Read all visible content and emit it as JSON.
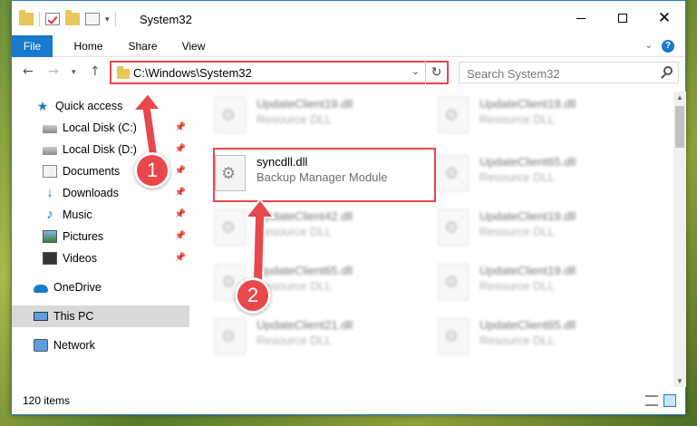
{
  "window": {
    "title": "System32",
    "qat_dropdown_arrow": "▾"
  },
  "ribbon": {
    "tabs": [
      "File",
      "Home",
      "Share",
      "View"
    ],
    "help": "?"
  },
  "navbar": {
    "address": "C:\\Windows\\System32",
    "search_placeholder": "Search System32"
  },
  "sidebar": {
    "items": [
      {
        "label": "Quick access",
        "icon": "star-icon",
        "pinned": false
      },
      {
        "label": "Local Disk (C:)",
        "icon": "drive-icon",
        "pinned": true
      },
      {
        "label": "Local Disk (D:)",
        "icon": "drive-icon",
        "pinned": true
      },
      {
        "label": "Documents",
        "icon": "documents-icon",
        "pinned": true
      },
      {
        "label": "Downloads",
        "icon": "download-icon",
        "pinned": true
      },
      {
        "label": "Music",
        "icon": "music-icon",
        "pinned": true
      },
      {
        "label": "Pictures",
        "icon": "pictures-icon",
        "pinned": true
      },
      {
        "label": "Videos",
        "icon": "videos-icon",
        "pinned": true
      },
      {
        "label": "OneDrive",
        "icon": "cloud-icon",
        "pinned": false
      },
      {
        "label": "This PC",
        "icon": "pc-icon",
        "pinned": false,
        "selected": true
      },
      {
        "label": "Network",
        "icon": "network-icon",
        "pinned": false
      }
    ]
  },
  "files": [
    {
      "name": "UpdateClient19.dll",
      "desc": "Resource DLL",
      "blurred": true
    },
    {
      "name": "UpdateClient19.dll",
      "desc": "Resource DLL",
      "blurred": true
    },
    {
      "name": "syncdll.dll",
      "desc": "Backup Manager Module",
      "blurred": false
    },
    {
      "name": "UpdateClient65.dll",
      "desc": "Resource DLL",
      "blurred": true
    },
    {
      "name": "UpdateClient42.dll",
      "desc": "Resource DLL",
      "blurred": true
    },
    {
      "name": "UpdateClient19.dll",
      "desc": "Resource DLL",
      "blurred": true
    },
    {
      "name": "UpdateClient65.dll",
      "desc": "Resource DLL",
      "blurred": true
    },
    {
      "name": "UpdateClient19.dll",
      "desc": "Resource DLL",
      "blurred": true
    },
    {
      "name": "UpdateClient21.dll",
      "desc": "Resource DLL",
      "blurred": true
    },
    {
      "name": "UpdateClient65.dll",
      "desc": "Resource DLL",
      "blurred": true
    }
  ],
  "status": {
    "item_count": "120 items"
  },
  "annotations": {
    "badge1": "1",
    "badge2": "2",
    "color": "#e8474b"
  },
  "colors": {
    "accent": "#1979ca",
    "highlight": "#e8474b"
  }
}
